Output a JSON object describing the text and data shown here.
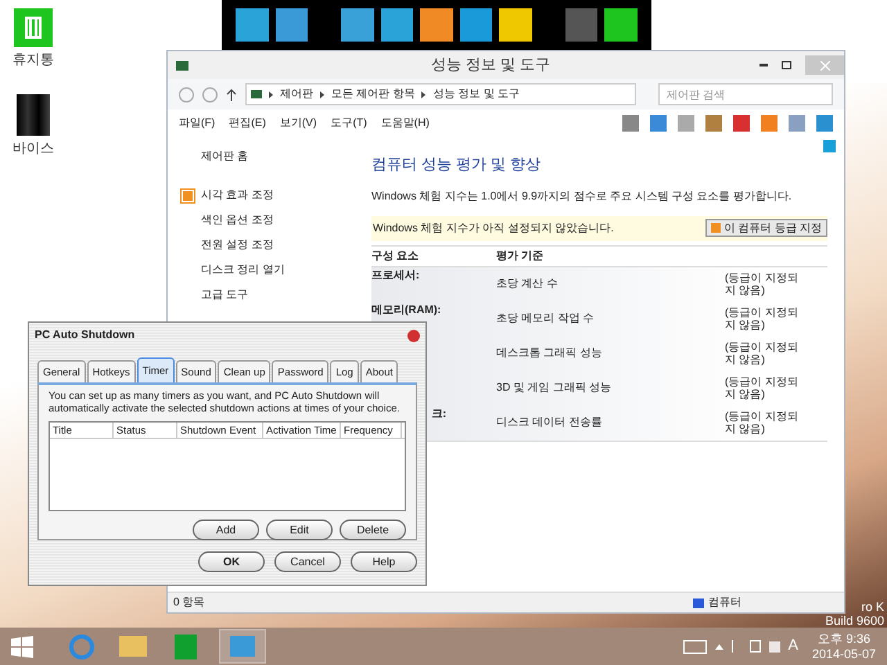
{
  "desktop_icons": [
    {
      "label": "휴지통",
      "kind": "bin"
    },
    {
      "label": "바이스",
      "kind": "box"
    }
  ],
  "explorer": {
    "title": "성능 정보 및 도구",
    "breadcrumb": [
      "제어판",
      "모든 제어판 항목",
      "성능 정보 및 도구"
    ],
    "search": {
      "placeholder": "제어판 검색"
    },
    "menu": [
      "파일(F)",
      "편집(E)",
      "보기(V)",
      "도구(T)",
      "도움말(H)"
    ],
    "sidebar": {
      "home": "제어판 홈",
      "items": [
        {
          "label": "시각 효과 조정",
          "kind": "shield"
        },
        {
          "label": "색인 옵션 조정",
          "kind": "plain"
        },
        {
          "label": "전원 설정 조정",
          "kind": "plain"
        },
        {
          "label": "디스크 정리 열기",
          "kind": "plain"
        },
        {
          "label": "고급 도구",
          "kind": "plain"
        }
      ]
    },
    "heading": "컴퓨터 성능 평가 및 향상",
    "description": "Windows 체험 지수는 1.0에서 9.9까지의 점수로 주요 시스템 구성 요소를 평가합니다.",
    "notice": "Windows 체험 지수가 아직 설정되지 않았습니다.",
    "rate_button": "이 컴퓨터 등급 지정",
    "columns": [
      "구성 요소",
      "평가 기준"
    ],
    "rows": [
      {
        "component": "프로세서:",
        "criterion": "초당 계산 수",
        "score": "(등급이 지정되\n지 않음)"
      },
      {
        "component": "메모리(RAM):",
        "criterion": "초당 메모리 작업 수",
        "score": "(등급이 지정되\n지 않음)"
      },
      {
        "criterion": "데스크톱 그래픽 성능",
        "score": "(등급이 지정되\n지 않음)"
      },
      {
        "criterion": "3D 및 게임 그래픽 성능",
        "score": "(등급이 지정되\n지 않음)"
      },
      {
        "component": "크:",
        "kind": "partial",
        "criterion": "디스크 데이터 전송률",
        "score": "(등급이 지정되\n지 않음)"
      }
    ],
    "status_bar": {
      "count": "0 항목",
      "location": "컴퓨터"
    }
  },
  "dialog": {
    "title": "PC Auto Shutdown",
    "tabs": [
      {
        "label": "General",
        "selected": false
      },
      {
        "label": "Hotkeys",
        "selected": false
      },
      {
        "label": "Timer",
        "selected": true
      },
      {
        "label": "Sound",
        "selected": false
      },
      {
        "label": "Clean up",
        "selected": false
      },
      {
        "label": "Password",
        "selected": false
      },
      {
        "label": "Log",
        "selected": false
      },
      {
        "label": "About",
        "selected": false
      }
    ],
    "description": "You can set up as many timers as you want, and PC Auto Shutdown will automatically activate the selected shutdown actions at times of your choice.",
    "columns": [
      "Title",
      "Status",
      "Shutdown Event",
      "Activation Time",
      "Frequency"
    ],
    "list_buttons": [
      "Add",
      "Edit",
      "Delete"
    ],
    "buttons": [
      "OK",
      "Cancel",
      "Help"
    ]
  },
  "watermark": [
    "ro K",
    "Build 9600"
  ],
  "taskbar": {
    "ime": "A",
    "time": "오후 9:36",
    "date": "2014-05-07"
  }
}
